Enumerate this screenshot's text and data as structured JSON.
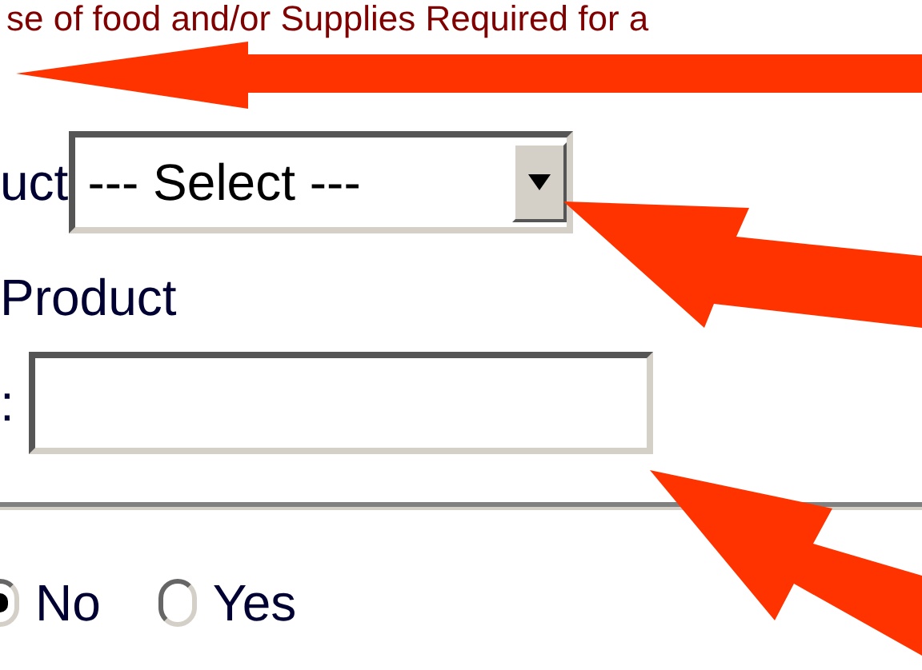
{
  "header_text": "se of food and/or Supplies Required for a",
  "product_select": {
    "label": "uct",
    "value": "--- Select ---"
  },
  "product_label": "Product",
  "product_input": {
    "label": ":"
  },
  "radio_options": [
    {
      "label": "No",
      "selected": true
    },
    {
      "label": "Yes",
      "selected": false
    }
  ]
}
